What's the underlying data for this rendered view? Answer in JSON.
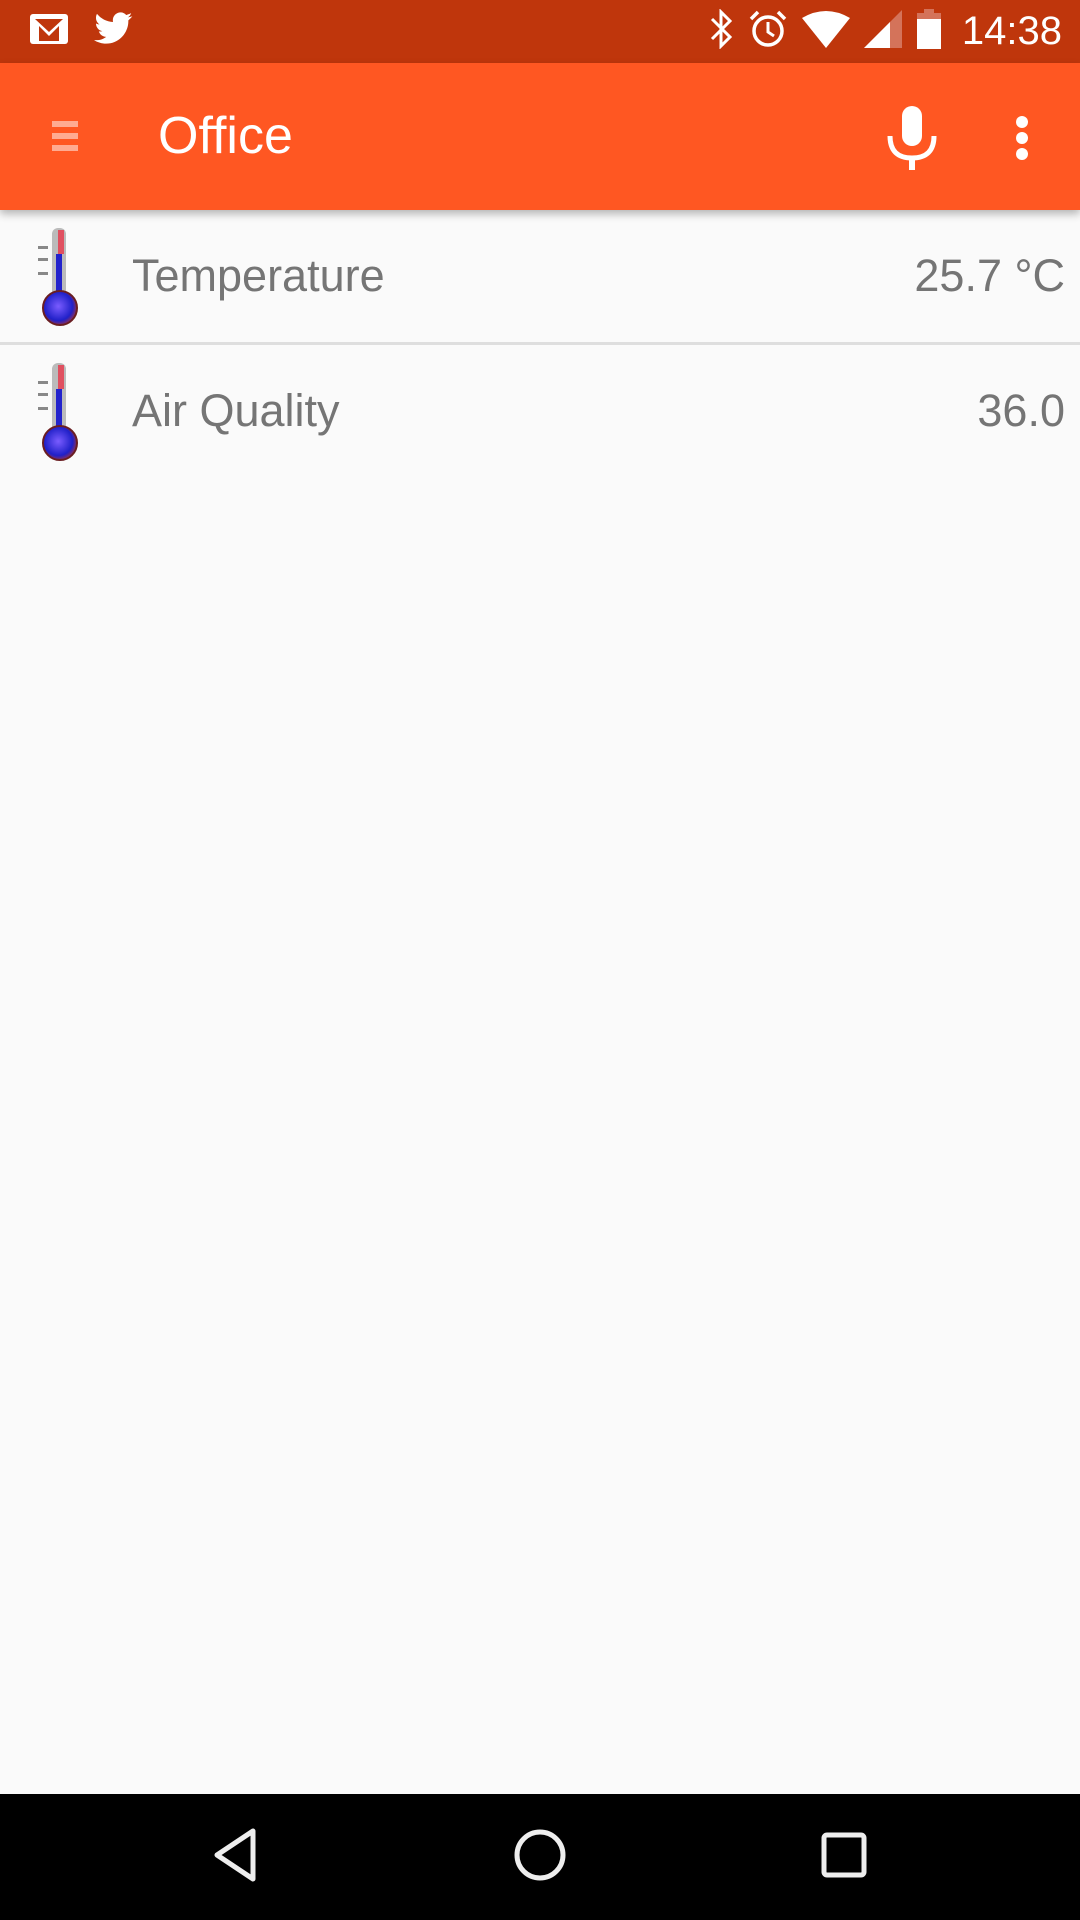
{
  "status_bar": {
    "notifications": [
      {
        "icon": "gmail-icon"
      },
      {
        "icon": "twitter-icon"
      }
    ],
    "system_icons": [
      "bluetooth-icon",
      "alarm-icon",
      "wifi-icon",
      "cell-signal-icon",
      "battery-icon"
    ],
    "time": "14:38"
  },
  "toolbar": {
    "title": "Office",
    "menu_icon": "hamburger-menu-icon",
    "actions": [
      {
        "icon": "microphone-icon",
        "label": "Voice input"
      },
      {
        "icon": "more-vert-icon",
        "label": "More options"
      }
    ]
  },
  "sensors": [
    {
      "icon": "thermometer-icon",
      "label": "Temperature",
      "value": "25.7 °C"
    },
    {
      "icon": "thermometer-icon",
      "label": "Air Quality",
      "value": "36.0"
    }
  ],
  "nav_bar": {
    "buttons": [
      {
        "icon": "back-icon"
      },
      {
        "icon": "home-icon"
      },
      {
        "icon": "recents-icon"
      }
    ]
  },
  "colors": {
    "status_bar": "#bf360c",
    "toolbar": "#ff5722",
    "background": "#fafafa",
    "text_secondary": "#757575",
    "divider": "#dedede"
  }
}
